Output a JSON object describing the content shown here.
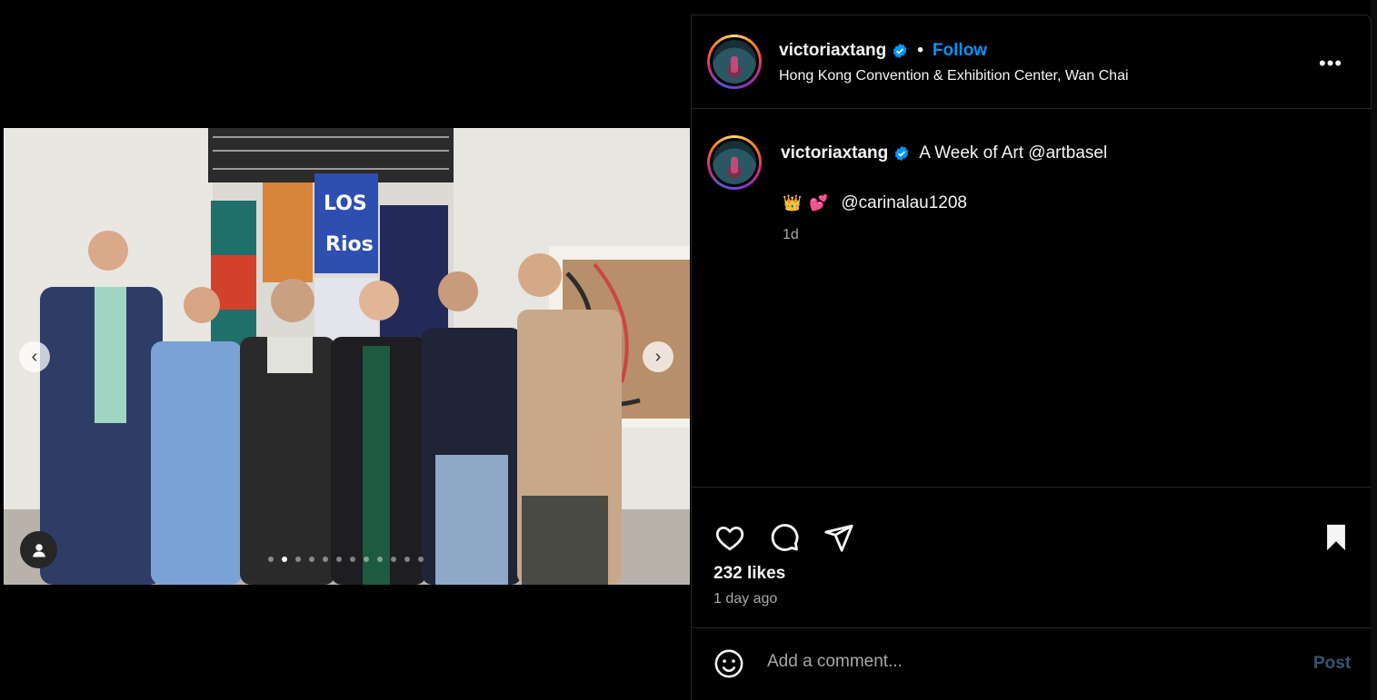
{
  "post": {
    "header": {
      "username": "victoriaxtang",
      "separator": "•",
      "follow_label": "Follow",
      "location": "Hong Kong Convention & Exhibition Center, Wan Chai",
      "more_label": "•••"
    },
    "caption": {
      "username": "victoriaxtang",
      "text": "A Week of Art @artbasel",
      "emoji_1": "👑",
      "emoji_2": "💕",
      "mention": "@carinalau1208",
      "time": "1d"
    },
    "media": {
      "prev_label": "‹",
      "next_label": "›",
      "slide_count": 12,
      "active_slide": 1
    },
    "actions": {
      "icons": [
        "heart-icon",
        "comment-icon",
        "share-icon",
        "bookmark-icon"
      ]
    },
    "likes": "232 likes",
    "posted": "1 day ago",
    "comment": {
      "placeholder": "Add a comment...",
      "post_label": "Post"
    }
  },
  "colors": {
    "background": "#000000",
    "accent": "#0095f6",
    "muted_text": "#a8a8a8",
    "post_disabled": "#36566f",
    "divider": "#262626"
  }
}
